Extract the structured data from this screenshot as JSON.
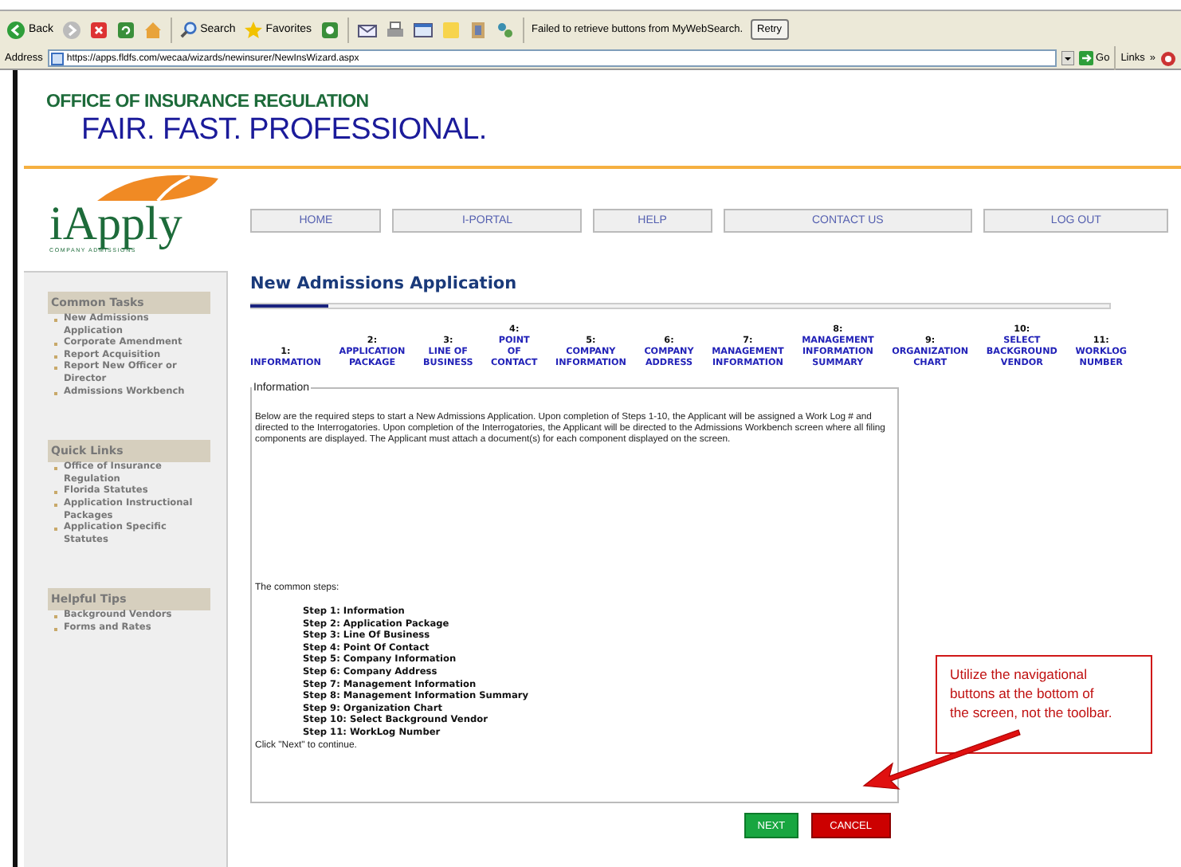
{
  "browser": {
    "toolbar": {
      "back": "Back",
      "search": "Search",
      "favorites": "Favorites",
      "message": "Failed to retrieve buttons from MyWebSearch.",
      "retry": "Retry"
    },
    "address_bar": {
      "label": "Address",
      "url": "https://apps.fldfs.com/wecaa/wizards/newinsurer/NewInsWizard.aspx",
      "go": "Go",
      "links": "Links",
      "chevron": "»"
    }
  },
  "header": {
    "agency": "OFFICE OF INSURANCE REGULATION",
    "slogan": "FAIR. FAST. PROFESSIONAL."
  },
  "logo": {
    "name": "iApply",
    "tagline": "COMPANY ADMISSIONS"
  },
  "nav": [
    "HOME",
    "I-PORTAL",
    "HELP",
    "CONTACT US",
    "LOG OUT"
  ],
  "sidebar": [
    {
      "title": "Common Tasks",
      "items": [
        "New Admissions Application",
        "Corporate Amendment",
        "Report Acquisition",
        "Report New Officer or Director",
        "Admissions Workbench"
      ]
    },
    {
      "title": "Quick Links",
      "items": [
        "Office of Insurance Regulation",
        "Florida Statutes",
        "Application Instructional Packages",
        "Application Specific Statutes"
      ]
    },
    {
      "title": "Helpful Tips",
      "items": [
        "Background Vendors",
        "Forms and Rates"
      ]
    }
  ],
  "main": {
    "title": "New Admissions Application",
    "progress": {
      "level": 0.09
    },
    "steps": [
      {
        "number": "1:",
        "label": "INFORMATION"
      },
      {
        "number": "2:",
        "label": "APPLICATION PACKAGE"
      },
      {
        "number": "3:",
        "label": "LINE OF BUSINESS"
      },
      {
        "number": "4:",
        "label": "POINT OF CONTACT"
      },
      {
        "number": "5:",
        "label": "COMPANY INFORMATION"
      },
      {
        "number": "6:",
        "label": "COMPANY ADDRESS"
      },
      {
        "number": "7:",
        "label": "MANAGEMENT INFORMATION"
      },
      {
        "number": "8:",
        "label": "MANAGEMENT INFORMATION SUMMARY"
      },
      {
        "number": "9:",
        "label": "ORGANIZATION CHART"
      },
      {
        "number": "10:",
        "label": "SELECT BACKGROUND VENDOR"
      },
      {
        "number": "11:",
        "label": "WORKLOG NUMBER"
      }
    ],
    "info": {
      "legend": "Information",
      "paragraph": "Below are the required steps to start a New Admissions Application.  Upon completion of Steps 1-10, the Applicant will be assigned a Work Log # and directed to the Interrogatories.  Upon completion of the Interrogatories, the Applicant will be directed to the Admissions Workbench screen where all filing components are displayed.  The Applicant must attach a document(s) for each component displayed on the screen.",
      "intro": "The common steps:",
      "steps": [
        "Step 1: Information",
        "Step 2: Application Package",
        "Step 3: Line Of Business",
        "Step 4: Point Of Contact",
        "Step 5: Company Information",
        "Step 6: Company Address",
        "Step 7: Management Information",
        "Step 8: Management Information Summary",
        "Step 9: Organization Chart",
        "Step 10: Select Background Vendor",
        "**Step 11: WorkLog** Number"
      ],
      "footer": "Click \"Next\" to continue."
    },
    "buttons": [
      {
        "label": "NEXT",
        "kind": "next"
      },
      {
        "label": "CANCEL",
        "kind": "cancel"
      }
    ]
  },
  "callout": {
    "text": "Utilize the navigational buttons at the bottom of the screen, not the toolbar."
  }
}
